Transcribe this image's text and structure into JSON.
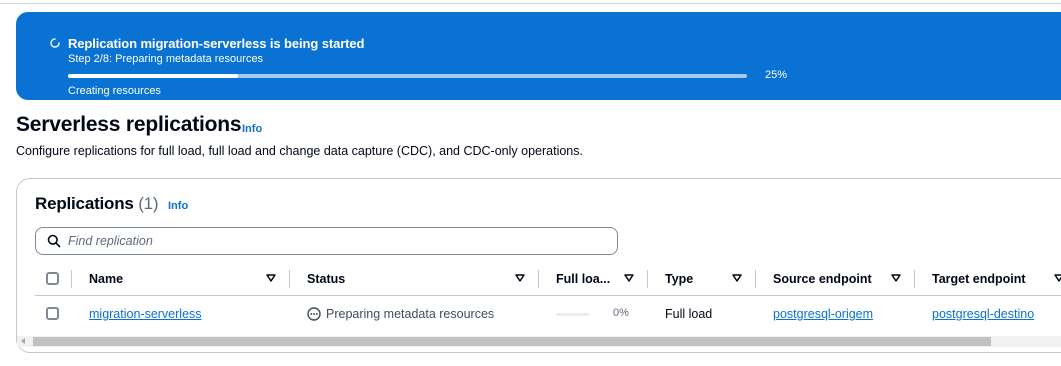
{
  "flash": {
    "title": "Replication migration-serverless is being started",
    "step": "Step 2/8: Preparing metadata resources",
    "progress_percent": 25,
    "progress_label": "25%",
    "sub": "Creating resources",
    "color": "#0972d3"
  },
  "page": {
    "title": "Serverless replications",
    "info": "Info",
    "description": "Configure replications for full load, full load and change data capture (CDC), and CDC-only operations."
  },
  "replications": {
    "title": "Replications",
    "count": "(1)",
    "info": "Info",
    "search_placeholder": "Find replication",
    "columns": [
      "Name",
      "Status",
      "Full loa...",
      "Type",
      "Source endpoint",
      "Target endpoint"
    ],
    "rows": [
      {
        "name": "migration-serverless",
        "status": "Preparing metadata resources",
        "full_load_percent": 0,
        "full_load": "0%",
        "type": "Full load",
        "source": "postgresql-origem",
        "target": "postgresql-destino"
      }
    ]
  },
  "icons": {
    "spinner": "loading-spinner-icon",
    "search": "search-icon",
    "sort": "sort-caret-down-icon",
    "status": "pending-ellipsis-icon"
  },
  "colors": {
    "link": "#0972d3",
    "text": "#000716",
    "muted": "#5f6b7a"
  }
}
